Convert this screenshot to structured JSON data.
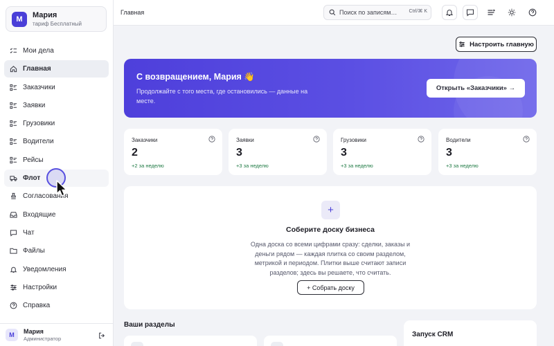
{
  "tenant": {
    "avatar": "М",
    "name": "Мария",
    "plan": "тариф Бесплатный"
  },
  "nav": [
    {
      "label": "Мои дела",
      "icon": "checklist-icon"
    },
    {
      "label": "Главная",
      "icon": "home-icon",
      "state": "active"
    },
    {
      "label": "Заказчики",
      "icon": "grid-list-icon"
    },
    {
      "label": "Заявки",
      "icon": "grid-list-icon"
    },
    {
      "label": "Грузовики",
      "icon": "grid-list-icon"
    },
    {
      "label": "Водители",
      "icon": "grid-list-icon"
    },
    {
      "label": "Рейсы",
      "icon": "grid-list-icon"
    },
    {
      "label": "Флот",
      "icon": "truck-icon",
      "state": "hover"
    },
    {
      "label": "Согласования",
      "icon": "stamp-icon"
    },
    {
      "label": "Входящие",
      "icon": "inbox-icon"
    },
    {
      "label": "Чат",
      "icon": "chat-icon"
    },
    {
      "label": "Файлы",
      "icon": "folder-icon"
    },
    {
      "label": "Уведомления",
      "icon": "bell-icon"
    },
    {
      "label": "Настройки",
      "icon": "sliders-icon"
    },
    {
      "label": "Справка",
      "icon": "help-icon"
    }
  ],
  "user": {
    "avatar": "М",
    "name": "Мария",
    "role": "Администратор"
  },
  "topbar": {
    "breadcrumb": "Главная",
    "search_placeholder": "Поиск по записям…",
    "shortcut": "Ctrl/⌘ K",
    "icons": [
      "bell-icon",
      "chat-icon",
      "list-icon",
      "sun-icon",
      "help-icon"
    ]
  },
  "main": {
    "customize_label": "Настроить главную",
    "hero": {
      "title": "С возвращением, Мария 👋",
      "text": "Продолжайте с того места, где остановились — данные на месте.",
      "button": "Открыть «Заказчики» →"
    },
    "stats": [
      {
        "label": "Заказчики",
        "value": "2",
        "delta": "+2 за неделю"
      },
      {
        "label": "Заявки",
        "value": "3",
        "delta": "+3 за неделю"
      },
      {
        "label": "Грузовики",
        "value": "3",
        "delta": "+3 за неделю"
      },
      {
        "label": "Водители",
        "value": "3",
        "delta": "+3 за неделю"
      }
    ],
    "board": {
      "plus": "+",
      "title": "Соберите доску бизнеса",
      "text": "Одна доска со всеми цифрами сразу: сделки, заказы и деньги рядом — каждая плитка со своим разделом, метрикой и периодом. Плитки выше считают записи разделов; здесь вы решаете, что считать.",
      "button": "+ Собрать доску"
    },
    "sections_title": "Ваши разделы",
    "crm_title": "Запуск CRM"
  },
  "colors": {
    "accent": "#4e3fdb",
    "positive": "#1f7a44"
  }
}
